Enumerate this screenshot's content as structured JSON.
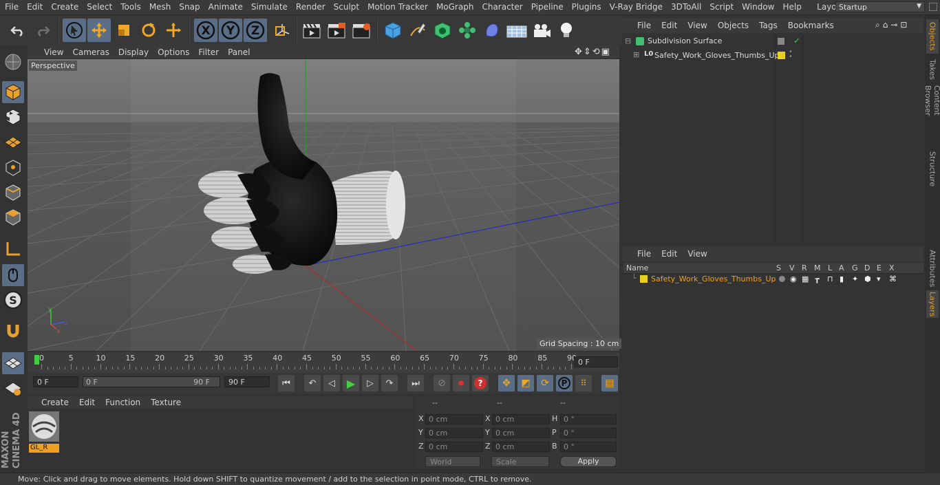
{
  "menu": [
    "File",
    "Edit",
    "Create",
    "Select",
    "Tools",
    "Mesh",
    "Snap",
    "Animate",
    "Simulate",
    "Render",
    "Sculpt",
    "Motion Tracker",
    "MoGraph",
    "Character",
    "Pipeline",
    "Plugins",
    "V-Ray Bridge",
    "3DToAll",
    "Script",
    "Window",
    "Help"
  ],
  "layout": {
    "label": "Layout:",
    "value": "Startup"
  },
  "viewport": {
    "menu": [
      "View",
      "Cameras",
      "Display",
      "Options",
      "Filter",
      "Panel"
    ],
    "camera_label": "Perspective",
    "grid_spacing": "Grid Spacing : 10 cm"
  },
  "timeline": {
    "ticks": [
      "0",
      "5",
      "10",
      "15",
      "20",
      "25",
      "30",
      "35",
      "40",
      "45",
      "50",
      "55",
      "60",
      "65",
      "70",
      "75",
      "80",
      "85",
      "90"
    ],
    "current_frame": "0 F",
    "start_field": "0 F",
    "range_start": "0 F",
    "range_end": "90 F",
    "end_field": "90 F"
  },
  "material_panel": {
    "menu": [
      "Create",
      "Edit",
      "Function",
      "Texture"
    ],
    "material_name": "GL_R"
  },
  "coordinates": {
    "headers": [
      "--",
      "--",
      "--"
    ],
    "rows": [
      {
        "l1": "X",
        "v1": "0 cm",
        "l2": "X",
        "v2": "0 cm",
        "l3": "H",
        "v3": "0 °"
      },
      {
        "l1": "Y",
        "v1": "0 cm",
        "l2": "Y",
        "v2": "0 cm",
        "l3": "P",
        "v3": "0 °"
      },
      {
        "l1": "Z",
        "v1": "0 cm",
        "l2": "Z",
        "v2": "0 cm",
        "l3": "B",
        "v3": "0 °"
      }
    ],
    "mode": "World",
    "scale": "Scale",
    "apply": "Apply"
  },
  "objects_panel": {
    "menu": [
      "File",
      "Edit",
      "View",
      "Objects",
      "Tags",
      "Bookmarks"
    ],
    "items": [
      {
        "name": "Subdivision Surface"
      },
      {
        "name": "Safety_Work_Gloves_Thumbs_Up"
      }
    ]
  },
  "layers_panel": {
    "menu": [
      "File",
      "Edit",
      "View"
    ],
    "columns": [
      "Name",
      "S",
      "V",
      "R",
      "M",
      "L",
      "A",
      "G",
      "D",
      "E",
      "X"
    ],
    "layer_name": "Safety_Work_Gloves_Thumbs_Up"
  },
  "side_tabs": [
    "Objects",
    "Takes",
    "Content Browser",
    "Structure",
    "Attributes",
    "Layers"
  ],
  "status": "Move: Click and drag to move elements. Hold down SHIFT to quantize movement / add to the selection in point mode, CTRL to remove.",
  "brand": "MAXON CINEMA 4D",
  "colors": {
    "accent": "#5a6e88",
    "layer_yellow": "#e8d020",
    "label_orange": "#f0a020"
  }
}
